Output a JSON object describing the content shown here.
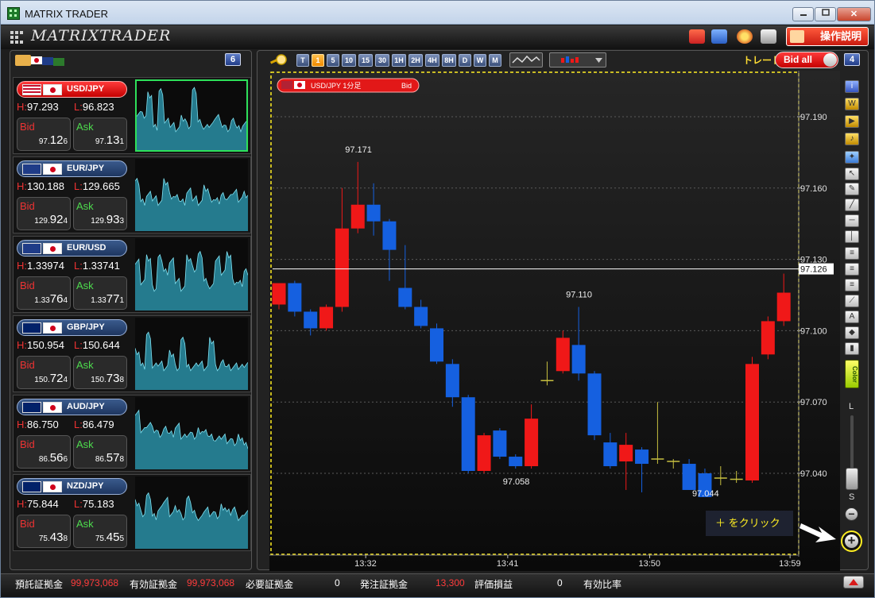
{
  "window": {
    "title": "MATRIX TRADER",
    "minimize_icon": "minimize-icon",
    "maximize_icon": "maximize-icon",
    "close_icon": "close-icon",
    "close_label": "✕"
  },
  "header": {
    "logo_text": "MATRIXTRADER",
    "help_label": "操作説明",
    "toolbar_icons": [
      "briefcase-icon",
      "save-icon",
      "palette-icon",
      "print-icon"
    ]
  },
  "colors": {
    "bull": "#f01818",
    "bear": "#1560e0",
    "doji": "#c8c040",
    "accent_yellow": "#ffee22",
    "grid": "#5a5a5a"
  },
  "pairs_panel": {
    "count": "6",
    "pairs": [
      {
        "name": "USD/JPY",
        "flag1": "us",
        "high_label": "H:",
        "high": "97.293",
        "low_label": "L:",
        "low": "96.823",
        "bid_label": "Bid",
        "ask_label": "Ask",
        "bid_pre": "97.",
        "bid_big": "12",
        "bid_post": "6",
        "ask_pre": "97.",
        "ask_big": "13",
        "ask_post": "1",
        "active": true
      },
      {
        "name": "EUR/JPY",
        "flag1": "eu",
        "high_label": "H:",
        "high": "130.188",
        "low_label": "L:",
        "low": "129.665",
        "bid_label": "Bid",
        "ask_label": "Ask",
        "bid_pre": "129.",
        "bid_big": "92",
        "bid_post": "4",
        "ask_pre": "129.",
        "ask_big": "93",
        "ask_post": "3",
        "active": false
      },
      {
        "name": "EUR/USD",
        "flag1": "eu",
        "high_label": "H:",
        "high": "1.33974",
        "low_label": "L:",
        "low": "1.33741",
        "bid_label": "Bid",
        "ask_label": "Ask",
        "bid_pre": "1.33",
        "bid_big": "76",
        "bid_post": "4",
        "ask_pre": "1.33",
        "ask_big": "77",
        "ask_post": "1",
        "active": false
      },
      {
        "name": "GBP/JPY",
        "flag1": "gb",
        "high_label": "H:",
        "high": "150.954",
        "low_label": "L:",
        "low": "150.644",
        "bid_label": "Bid",
        "ask_label": "Ask",
        "bid_pre": "150.",
        "bid_big": "72",
        "bid_post": "4",
        "ask_pre": "150.",
        "ask_big": "73",
        "ask_post": "8",
        "active": false
      },
      {
        "name": "AUD/JPY",
        "flag1": "au",
        "high_label": "H:",
        "high": "86.750",
        "low_label": "L:",
        "low": "86.479",
        "bid_label": "Bid",
        "ask_label": "Ask",
        "bid_pre": "86.",
        "bid_big": "56",
        "bid_post": "6",
        "ask_pre": "86.",
        "ask_big": "57",
        "ask_post": "8",
        "active": false
      },
      {
        "name": "NZD/JPY",
        "flag1": "nz",
        "high_label": "H:",
        "high": "75.844",
        "low_label": "L:",
        "low": "75.183",
        "bid_label": "Bid",
        "ask_label": "Ask",
        "bid_pre": "75.",
        "bid_big": "43",
        "bid_post": "8",
        "ask_pre": "75.",
        "ask_big": "45",
        "ask_post": "5",
        "active": false
      }
    ]
  },
  "chart_toolbar": {
    "timeframes": [
      "T",
      "1",
      "5",
      "10",
      "15",
      "30",
      "1H",
      "2H",
      "4H",
      "8H",
      "D",
      "W",
      "M"
    ],
    "selected_timeframe": "1",
    "trade_label": "トレード",
    "bid_toggle_label": "Bid all",
    "chart_count": "4"
  },
  "chart_data": {
    "type": "candlestick",
    "legend": "USD/JPY 1分足",
    "legend_price_type": "Bid",
    "y_ticks": [
      97.19,
      97.16,
      97.13,
      97.1,
      97.07,
      97.04
    ],
    "y_tick_labels": [
      "97.190",
      "97.160",
      "97.130",
      "97.100",
      "97.070",
      "97.040"
    ],
    "x_tick_labels": [
      "13:32",
      "13:41",
      "13:50",
      "13:59"
    ],
    "current_price": "97.126",
    "current_value": 97.126,
    "annotations": [
      {
        "label": "97.171"
      },
      {
        "label": "97.110"
      },
      {
        "label": "97.058"
      },
      {
        "label": "97.044"
      }
    ],
    "candles": [
      {
        "o": 97.111,
        "h": 97.113,
        "l": 97.109,
        "c": 97.12
      },
      {
        "o": 97.12,
        "h": 97.121,
        "l": 97.106,
        "c": 97.108
      },
      {
        "o": 97.108,
        "h": 97.109,
        "l": 97.098,
        "c": 97.101
      },
      {
        "o": 97.101,
        "h": 97.111,
        "l": 97.1,
        "c": 97.11
      },
      {
        "o": 97.11,
        "h": 97.16,
        "l": 97.108,
        "c": 97.143
      },
      {
        "o": 97.143,
        "h": 97.171,
        "l": 97.141,
        "c": 97.153
      },
      {
        "o": 97.153,
        "h": 97.162,
        "l": 97.14,
        "c": 97.146
      },
      {
        "o": 97.146,
        "h": 97.147,
        "l": 97.121,
        "c": 97.134
      },
      {
        "o": 97.118,
        "h": 97.136,
        "l": 97.109,
        "c": 97.11
      },
      {
        "o": 97.11,
        "h": 97.113,
        "l": 97.101,
        "c": 97.102
      },
      {
        "o": 97.101,
        "h": 97.103,
        "l": 97.086,
        "c": 97.087
      },
      {
        "o": 97.086,
        "h": 97.088,
        "l": 97.068,
        "c": 97.072
      },
      {
        "o": 97.072,
        "h": 97.073,
        "l": 97.04,
        "c": 97.041
      },
      {
        "o": 97.041,
        "h": 97.057,
        "l": 97.04,
        "c": 97.056
      },
      {
        "o": 97.058,
        "h": 97.059,
        "l": 97.046,
        "c": 97.047
      },
      {
        "o": 97.047,
        "h": 97.048,
        "l": 97.042,
        "c": 97.043
      },
      {
        "o": 97.043,
        "h": 97.069,
        "l": 97.042,
        "c": 97.063
      },
      {
        "o": 97.08,
        "h": 97.087,
        "l": 97.077,
        "c": 97.078
      },
      {
        "o": 97.083,
        "h": 97.1,
        "l": 97.082,
        "c": 97.097
      },
      {
        "o": 97.094,
        "h": 97.11,
        "l": 97.079,
        "c": 97.082
      },
      {
        "o": 97.082,
        "h": 97.083,
        "l": 97.054,
        "c": 97.056
      },
      {
        "o": 97.053,
        "h": 97.057,
        "l": 97.042,
        "c": 97.043
      },
      {
        "o": 97.045,
        "h": 97.057,
        "l": 97.033,
        "c": 97.052
      },
      {
        "o": 97.05,
        "h": 97.051,
        "l": 97.032,
        "c": 97.044
      },
      {
        "o": 97.046,
        "h": 97.07,
        "l": 97.044,
        "c": 97.046
      },
      {
        "o": 97.045,
        "h": 97.046,
        "l": 97.042,
        "c": 97.045
      },
      {
        "o": 97.044,
        "h": 97.046,
        "l": 97.033,
        "c": 97.033
      },
      {
        "o": 97.04,
        "h": 97.042,
        "l": 97.037,
        "c": 97.03
      },
      {
        "o": 97.038,
        "h": 97.043,
        "l": 97.035,
        "c": 97.038
      },
      {
        "o": 97.037,
        "h": 97.041,
        "l": 97.036,
        "c": 97.038
      },
      {
        "o": 97.037,
        "h": 97.089,
        "l": 97.036,
        "c": 97.086
      },
      {
        "o": 97.09,
        "h": 97.106,
        "l": 97.088,
        "c": 97.104
      },
      {
        "o": 97.104,
        "h": 97.124,
        "l": 97.102,
        "c": 97.116
      }
    ]
  },
  "side_tools": [
    "info-icon",
    "news-icon",
    "chart-flag-icon",
    "bell-icon",
    "indicator-icon",
    "cursor-icon",
    "pen-icon",
    "trendline-icon",
    "horizontal-line-icon",
    "vertical-line-icon",
    "fibonacci-icon",
    "channel-icon",
    "parallel-icon",
    "fan-icon",
    "text-tool-icon",
    "eraser-icon",
    "trash-icon"
  ],
  "zoom": {
    "large_label": "L",
    "small_label": "S",
    "minus_label": "−",
    "plus_label": "+"
  },
  "hint": {
    "text": "＋ をクリック"
  },
  "status_bar": {
    "items": [
      {
        "label": "預託証拠金",
        "value": "99,973,068"
      },
      {
        "label": "有効証拠金",
        "value": "99,973,068"
      },
      {
        "label": "必要証拠金",
        "value": "0"
      },
      {
        "label": "発注証拠金",
        "value": "13,300"
      },
      {
        "label": "評価損益",
        "value": "0"
      },
      {
        "label": "有効比率",
        "value": ""
      }
    ]
  }
}
